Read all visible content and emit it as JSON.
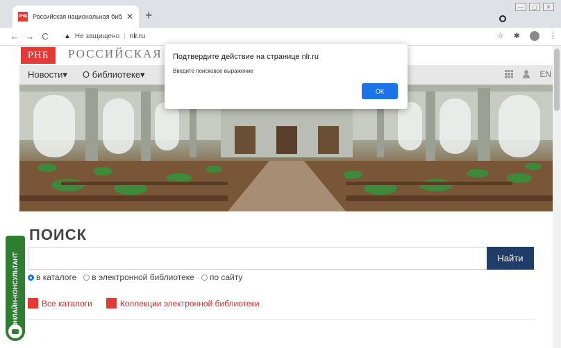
{
  "browser": {
    "tab_favicon_text": "РНБ",
    "tab_title": "Российская национальная библ",
    "tab_close": "✕",
    "new_tab": "+",
    "back": "←",
    "forward": "→",
    "reload": "C",
    "warning_icon": "▲",
    "insecure_label": "Не защищено",
    "separator": "|",
    "url": "nlr.ru",
    "star_icon": "☆",
    "extensions_icon": "✱",
    "menu_icon": "⋮",
    "window_minimize": "—",
    "window_maximize": "▢",
    "window_close": "✕"
  },
  "site": {
    "logo": "РНБ",
    "name": "РОССИЙСКАЯ",
    "nav": [
      {
        "label": "Новости▾"
      },
      {
        "label": "О библиотеке▾"
      }
    ],
    "lang": "EN",
    "accent_red": "#e53935",
    "accent_blue": "#1f3d66"
  },
  "search": {
    "title": "ПОИСК",
    "input_value": "",
    "button_label": "Найти",
    "radios": [
      {
        "label": "в каталоге",
        "selected": true
      },
      {
        "label": "в электронной библиотеке",
        "selected": false
      },
      {
        "label": "по сайту",
        "selected": false
      }
    ],
    "links": [
      {
        "label": "Все каталоги"
      },
      {
        "label": "Коллекции электронной библиотеки"
      }
    ]
  },
  "consultant": {
    "label": "ОНЛАЙН-КОНСУЛЬТАНТ"
  },
  "dialog": {
    "title": "Подтвердите действие на странице nlr.ru",
    "message": "Введите поисковое выражение",
    "ok_label": "ОК"
  }
}
